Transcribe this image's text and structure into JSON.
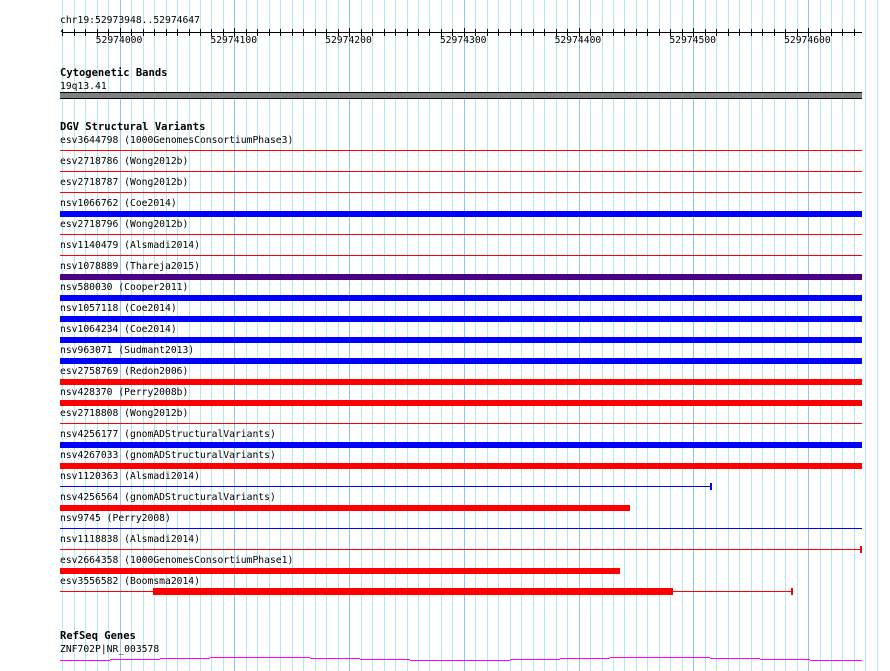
{
  "view": {
    "location": "chr19:52973948..52974647",
    "start": 52973948,
    "end": 52974647,
    "ruler_labels": [
      "52974000",
      "52974100",
      "52974200",
      "52974300",
      "52974400",
      "52974500",
      "52974600"
    ]
  },
  "tracks": {
    "cytoband": {
      "title": "Cytogenetic Bands",
      "band": "19q13.41",
      "color": "#808080"
    },
    "dgv": {
      "title": "DGV Structural Variants",
      "colors": {
        "loss": "#ff0000",
        "gain": "#0000ff",
        "both": "#4b0082"
      },
      "features": [
        {
          "label": "esv3644798 (1000GenomesConsortiumPhase3)",
          "color": "loss",
          "style": "thin",
          "start": 52973948,
          "end": 52974647
        },
        {
          "label": "esv2718786 (Wong2012b)",
          "color": "loss",
          "style": "thin",
          "start": 52973948,
          "end": 52974647
        },
        {
          "label": "esv2718787 (Wong2012b)",
          "color": "loss",
          "style": "thin",
          "start": 52973948,
          "end": 52974647
        },
        {
          "label": "nsv1066762 (Coe2014)",
          "color": "gain",
          "style": "thick",
          "start": 52973948,
          "end": 52974647
        },
        {
          "label": "esv2718796 (Wong2012b)",
          "color": "loss",
          "style": "thin",
          "start": 52973948,
          "end": 52974647
        },
        {
          "label": "nsv1140479 (Alsmadi2014)",
          "color": "loss",
          "style": "thin",
          "start": 52973948,
          "end": 52974647
        },
        {
          "label": "nsv1078889 (Thareja2015)",
          "color": "both",
          "style": "thick",
          "start": 52973948,
          "end": 52974647
        },
        {
          "label": "nsv580030 (Cooper2011)",
          "color": "gain",
          "style": "thick",
          "start": 52973948,
          "end": 52974647
        },
        {
          "label": "nsv1057118 (Coe2014)",
          "color": "gain",
          "style": "thick",
          "start": 52973948,
          "end": 52974647
        },
        {
          "label": "nsv1064234 (Coe2014)",
          "color": "gain",
          "style": "thick",
          "start": 52973948,
          "end": 52974647
        },
        {
          "label": "nsv963071 (Sudmant2013)",
          "color": "gain",
          "style": "thick",
          "start": 52973948,
          "end": 52974647
        },
        {
          "label": "esv2758769 (Redon2006)",
          "color": "loss",
          "style": "thick",
          "start": 52973948,
          "end": 52974647
        },
        {
          "label": "nsv428370 (Perry2008b)",
          "color": "loss",
          "style": "thick",
          "start": 52973948,
          "end": 52974647
        },
        {
          "label": "esv2718808 (Wong2012b)",
          "color": "loss",
          "style": "thin",
          "start": 52973948,
          "end": 52974647
        },
        {
          "label": "nsv4256177 (gnomADStructuralVariants)",
          "color": "gain",
          "style": "thick",
          "start": 52973948,
          "end": 52974647
        },
        {
          "label": "nsv4267033 (gnomADStructuralVariants)",
          "color": "loss",
          "style": "thick",
          "start": 52973948,
          "end": 52974647
        },
        {
          "label": "nsv1120363 (Alsmadi2014)",
          "color": "gain",
          "style": "thin",
          "start": 52973948,
          "end": 52974515,
          "end_tick": true
        },
        {
          "label": "nsv4256564 (gnomADStructuralVariants)",
          "color": "loss",
          "style": "thick",
          "start": 52973948,
          "end": 52974445
        },
        {
          "label": "nsv9745 (Perry2008)",
          "color": "gain",
          "style": "thin",
          "start": 52973948,
          "end": 52974647
        },
        {
          "label": "nsv1118838 (Alsmadi2014)",
          "color": "loss",
          "style": "thin",
          "start": 52973948,
          "end": 52974646,
          "end_tick": true
        },
        {
          "label": "esv2664358 (1000GenomesConsortiumPhase1)",
          "color": "loss",
          "style": "thick",
          "start": 52973948,
          "end": 52974436
        },
        {
          "label": "esv3556582 (Boomsma2014)",
          "color": "loss",
          "style": "thin",
          "start": 52973948,
          "end": 52974586,
          "end_tick": true,
          "thick_start": 52974029,
          "thick_end": 52974482
        }
      ]
    },
    "refseq": {
      "title": "RefSeq Genes",
      "gene": "ZNF702P|NR_003578",
      "color": "#ff00ff"
    }
  }
}
